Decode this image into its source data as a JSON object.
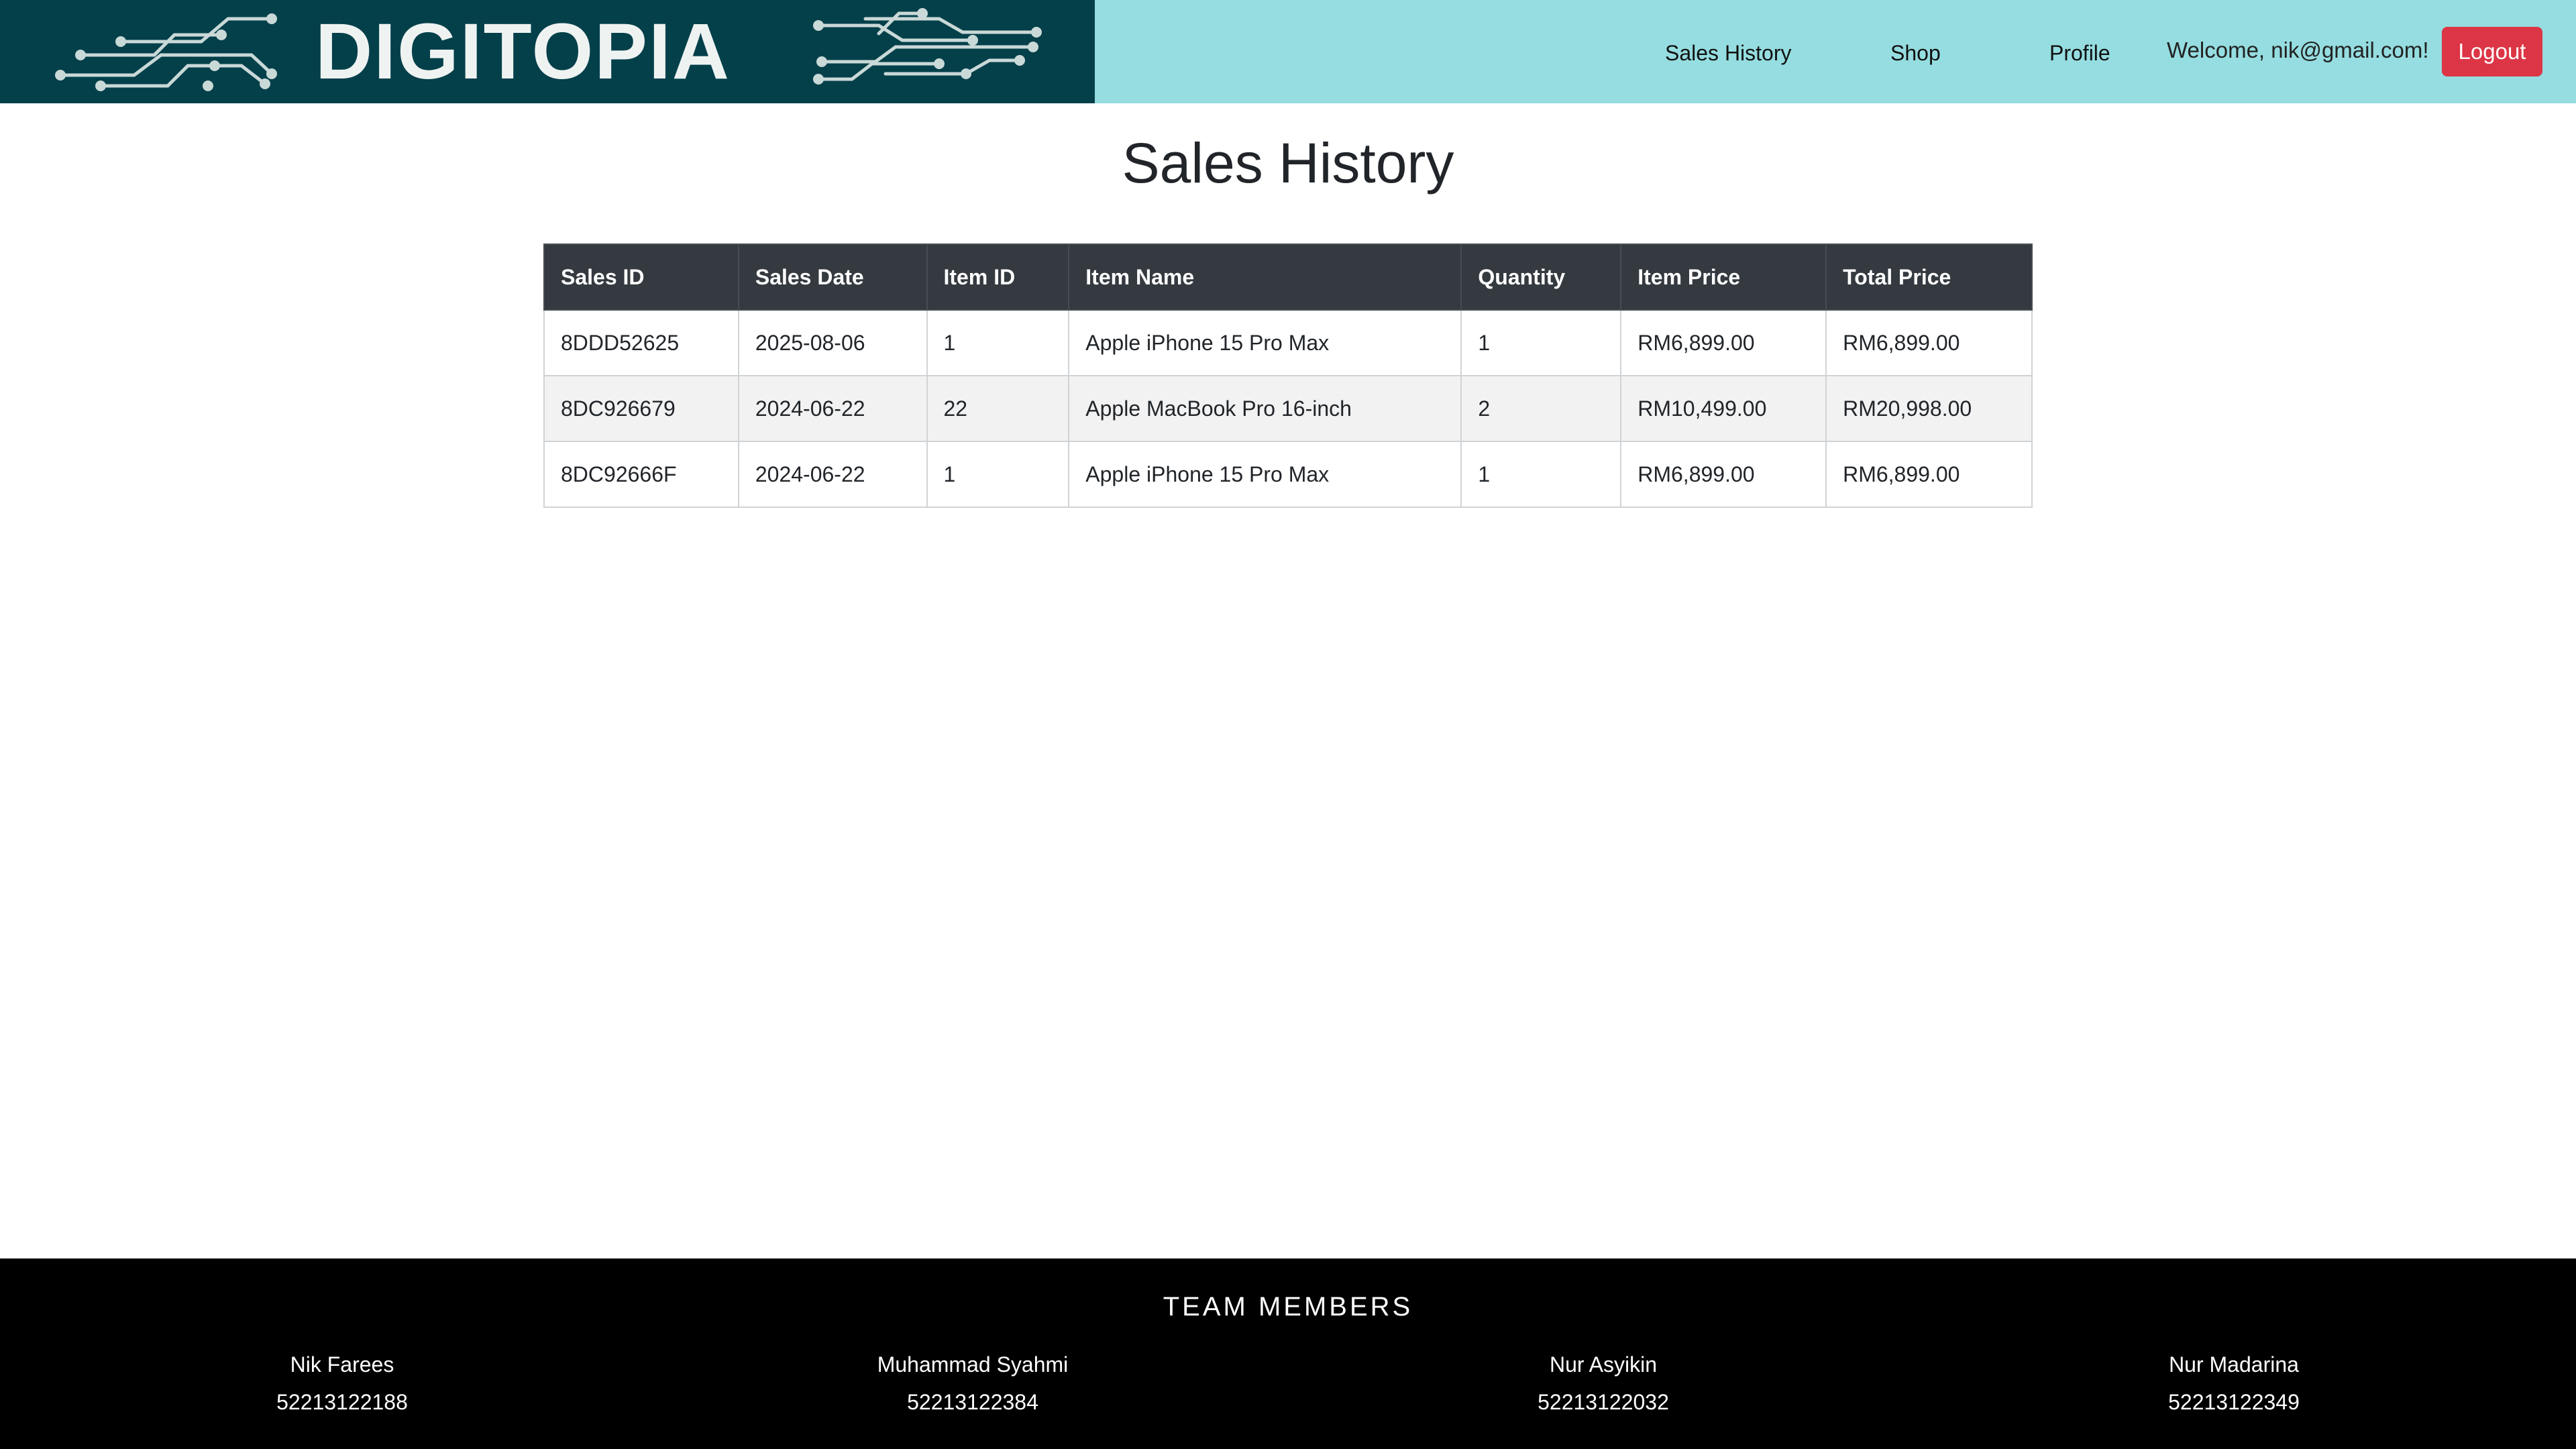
{
  "brand": {
    "name": "DIGITOPIA"
  },
  "nav": {
    "links": [
      "Sales History",
      "Shop",
      "Profile"
    ],
    "welcome": "Welcome, nik@gmail.com!",
    "logout_label": "Logout"
  },
  "colors": {
    "header_bg": "#95dde0",
    "logo_bg": "#04404a",
    "logout_bg": "#dc3545",
    "table_header_bg": "#343a40",
    "footer_bg": "#000000"
  },
  "page": {
    "title": "Sales History"
  },
  "table": {
    "headers": [
      "Sales ID",
      "Sales Date",
      "Item ID",
      "Item Name",
      "Quantity",
      "Item Price",
      "Total Price"
    ],
    "rows": [
      [
        "8DDD52625",
        "2025-08-06",
        "1",
        "Apple iPhone 15 Pro Max",
        "1",
        "RM6,899.00",
        "RM6,899.00"
      ],
      [
        "8DC926679",
        "2024-06-22",
        "22",
        "Apple MacBook Pro 16-inch",
        "2",
        "RM10,499.00",
        "RM20,998.00"
      ],
      [
        "8DC92666F",
        "2024-06-22",
        "1",
        "Apple iPhone 15 Pro Max",
        "1",
        "RM6,899.00",
        "RM6,899.00"
      ]
    ]
  },
  "footer": {
    "title": "TEAM MEMBERS",
    "members": [
      {
        "name": "Nik Farees",
        "id": "52213122188"
      },
      {
        "name": "Muhammad Syahmi",
        "id": "52213122384"
      },
      {
        "name": "Nur Asyikin",
        "id": "52213122032"
      },
      {
        "name": "Nur Madarina",
        "id": "52213122349"
      }
    ]
  }
}
